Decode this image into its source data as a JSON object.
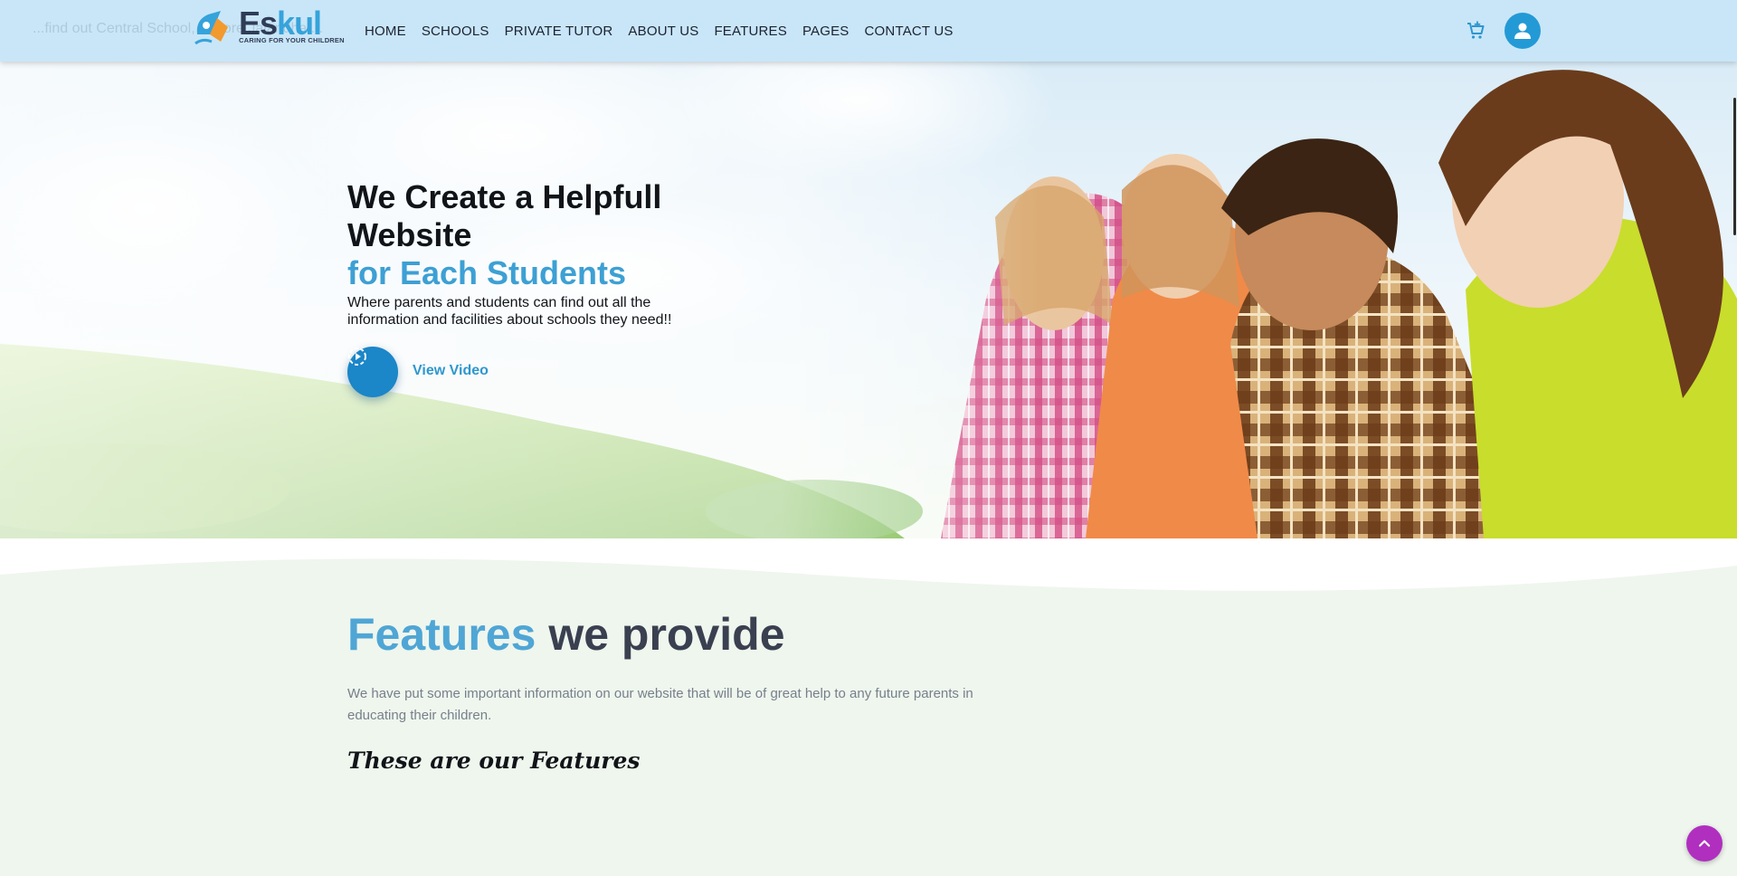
{
  "header": {
    "ghost_text": "...find out Central School, Lahore Jalandhar...",
    "logo": {
      "word_part1": "Es",
      "word_part2": "kul",
      "tagline": "CARING FOR YOUR CHILDREN"
    },
    "nav": [
      "HOME",
      "SCHOOLS",
      "PRIVATE TUTOR",
      "ABOUT US",
      "FEATURES",
      "PAGES",
      "CONTACT US"
    ],
    "cart_icon": "cart-plus-icon",
    "account_icon": "user-icon"
  },
  "hero": {
    "title": "We Create a Helpfull Website",
    "title_accent": "for Each Students",
    "subtitle": "Where parents and students can find out all the information and facilities about schools they need!!",
    "video_label": "View Video",
    "video_icon": "play-circle-icon"
  },
  "features": {
    "heading_accent": "Features",
    "heading_rest": "we provide",
    "description": "We have put some important information on our website that will be of great help to any future parents in educating their children.",
    "subheading": "These are our Features"
  },
  "back_to_top_icon": "chevron-up-icon",
  "colors": {
    "header_bg": "#c9e6f8",
    "brand_blue": "#36a3db",
    "brand_dark": "#2f3c57",
    "video_button": "#1b86c8",
    "features_bg": "#eff6ee",
    "back_to_top": "#b02fbf"
  }
}
